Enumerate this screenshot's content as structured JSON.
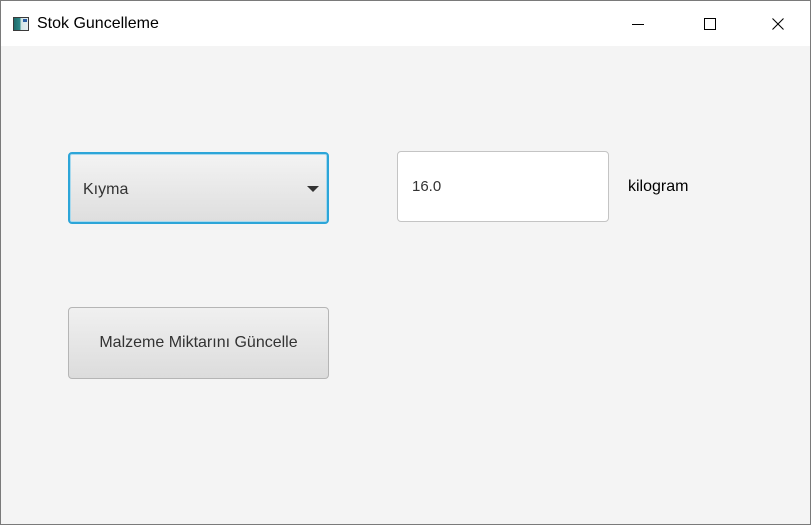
{
  "window": {
    "title": "Stok Guncelleme",
    "icon": "java-app-icon",
    "controls": {
      "minimize_icon": "minimize-icon",
      "maximize_icon": "maximize-icon",
      "close_icon": "close-icon"
    }
  },
  "form": {
    "material_combo": {
      "selected": "Kıyma",
      "icon": "chevron-down-icon"
    },
    "quantity_field": {
      "value": "16.0",
      "placeholder": ""
    },
    "unit_label": "kilogram",
    "update_button_label": "Malzeme Miktarını Güncelle"
  },
  "colors": {
    "focus_accent": "#2ca5d8",
    "window_background": "#f4f4f4",
    "titlebar_background": "#ffffff"
  }
}
